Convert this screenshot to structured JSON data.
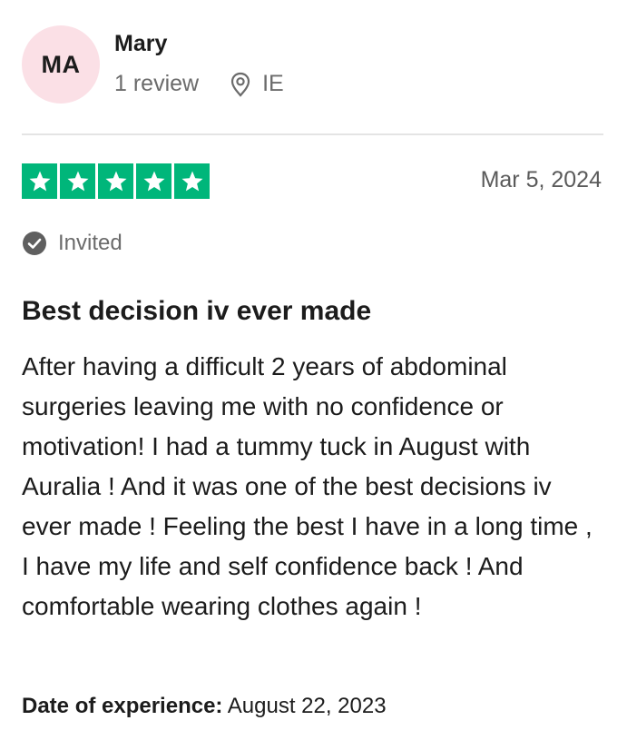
{
  "reviewer": {
    "initials": "MA",
    "name": "Mary",
    "review_count": "1 review",
    "location": "IE",
    "avatar_color": "#fbe0e6"
  },
  "review": {
    "rating": 5,
    "max_rating": 5,
    "star_color": "#00b67a",
    "date": "Mar 5, 2024",
    "badge": "Invited",
    "title": "Best decision iv ever made",
    "body": "After having a difficult 2 years of abdominal surgeries leaving me with no confidence or motivation! I had a tummy tuck in August with Auralia ! And it was one of the best decisions iv ever made ! Feeling the best I have in a long time , I have my life and self confidence back ! And comfortable wearing clothes again !",
    "experience_label": "Date of experience:",
    "experience_date": "August 22, 2023"
  },
  "icons": {
    "location": "map-pin-icon",
    "verified": "check-circle-icon",
    "star": "star-icon"
  }
}
